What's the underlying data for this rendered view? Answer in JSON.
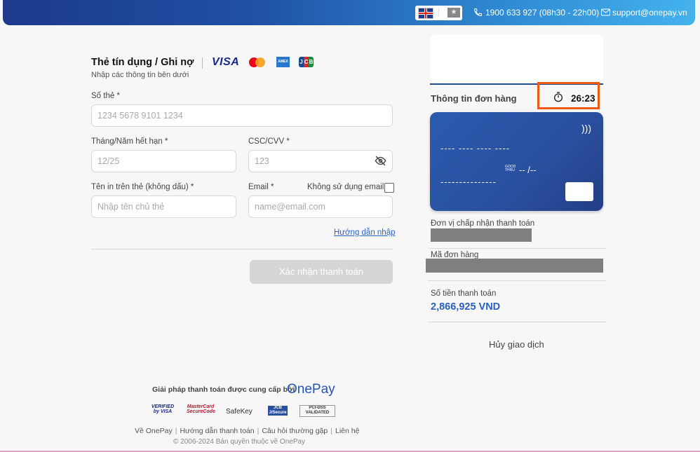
{
  "header": {
    "phone": "1900 633 927 (08h30 - 22h00)",
    "email": "support@onepay.vn",
    "lang_current": "English",
    "lang_other": "★"
  },
  "form": {
    "title": "Thẻ tín dụng / Ghi nợ",
    "subtitle": "Nhập các thông tin bên dưới",
    "brands": [
      "VISA",
      "MasterCard",
      "AMEX",
      "JCB"
    ],
    "card_number_label": "Số thẻ *",
    "card_number_placeholder": "1234 5678 9101 1234",
    "expiry_label": "Tháng/Năm hết hạn *",
    "expiry_placeholder": "12/25",
    "cvv_label": "CSC/CVV *",
    "cvv_placeholder": "123",
    "name_label": "Tên in trên thẻ (không dấu) *",
    "name_placeholder": "Nhập tên chủ thẻ",
    "email_label": "Email *",
    "email_placeholder": "name@email.com",
    "no_email_label": "Không sử dụng email",
    "guide_link": "Hướng dẫn nhập",
    "confirm_button": "Xác nhận thanh toán"
  },
  "footer": {
    "provided_by": "Giải pháp thanh toán được cung cấp bởi",
    "brand": "OnePay",
    "pay_logos": [
      "VERIFIED by VISA",
      "MasterCard SecureCode",
      "SafeKey",
      "JCB J/Secure",
      "PCI-DSS VALIDATED"
    ],
    "links": [
      "Về OnePay",
      "Hướng dẫn thanh toán",
      "Câu hỏi thường gặp",
      "Liên hệ"
    ],
    "copyright": "© 2006-2024 Bản quyền thuộc về OnePay"
  },
  "order": {
    "title": "Thông tin đơn hàng",
    "timer": "26:23",
    "card_number_mask": "---- ---- ---- ----",
    "card_thru": "GOOD THRU",
    "card_expiry_mask": "-- /--",
    "card_name_mask": "---------------",
    "merchant_label": "Đơn vị chấp nhận thanh toán",
    "order_id_label": "Mã đơn hàng",
    "amount_label": "Số tiền thanh toán",
    "amount_value": "2,866,925 VND",
    "cancel": "Hủy giao dịch"
  },
  "colors": {
    "accent": "#2a5fbd",
    "timer_highlight": "#ef5a16",
    "header_start": "#1d3a8c",
    "header_end": "#43b3ee"
  }
}
